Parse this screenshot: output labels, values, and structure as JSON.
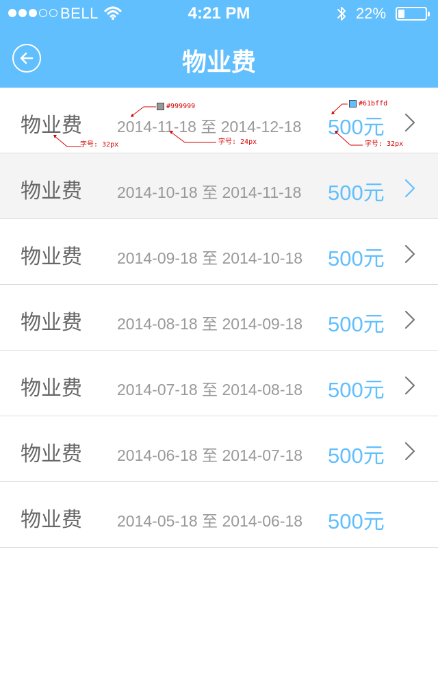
{
  "status_bar": {
    "carrier": "BELL",
    "time": "4:21 PM",
    "battery": "22%",
    "battery_level": 0.22,
    "signal_bars_filled": 3,
    "signal_bars_total": 5
  },
  "header": {
    "title": "物业费",
    "background_color": "#61bffd"
  },
  "rows": [
    {
      "title": "物业费",
      "from": "2014-11-18",
      "sep": "至",
      "to": "2014-12-18",
      "amount": "500元",
      "has_chevron": true
    },
    {
      "title": "物业费",
      "from": "2014-10-18",
      "sep": "至",
      "to": "2014-11-18",
      "amount": "500元",
      "has_chevron": true,
      "highlighted": true
    },
    {
      "title": "物业费",
      "from": "2014-09-18",
      "sep": "至",
      "to": "2014-10-18",
      "amount": "500元",
      "has_chevron": true
    },
    {
      "title": "物业费",
      "from": "2014-08-18",
      "sep": "至",
      "to": "2014-09-18",
      "amount": "500元",
      "has_chevron": true
    },
    {
      "title": "物业费",
      "from": "2014-07-18",
      "sep": "至",
      "to": "2014-08-18",
      "amount": "500元",
      "has_chevron": true
    },
    {
      "title": "物业费",
      "from": "2014-06-18",
      "sep": "至",
      "to": "2014-07-18",
      "amount": "500元",
      "has_chevron": true
    },
    {
      "title": "物业费",
      "from": "2014-05-18",
      "sep": "至",
      "to": "2014-06-18",
      "amount": "500元",
      "has_chevron": false
    }
  ],
  "annotations": {
    "date_color": "#999999",
    "amount_color": "#61bffd",
    "title_font": "字号: 32px",
    "date_font": "字号: 24px",
    "amount_font": "字号: 32px"
  },
  "icons": {
    "back": "back-arrow-circle-icon",
    "chevron": "chevron-right-icon",
    "wifi": "wifi-icon",
    "bluetooth": "bluetooth-icon"
  }
}
